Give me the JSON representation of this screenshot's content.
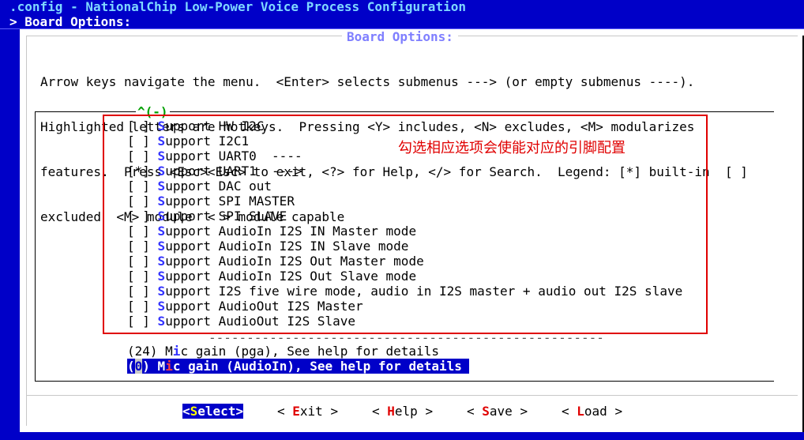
{
  "window": {
    "title": ".config - NationalChip Low-Power Voice Process Configuration",
    "breadcrumb": "> Board Options:"
  },
  "dialog": {
    "title": "Board Options:",
    "help_lines": [
      "Arrow keys navigate the menu.  <Enter> selects submenus ---> (or empty submenus ----).",
      "Highlighted letters are hotkeys.  Pressing <Y> includes, <N> excludes, <M> modularizes",
      "features.  Press <Esc><Esc> to exit, <?> for Help, </> for Search.  Legend: [*] built-in  [ ]",
      "excluded  <M> module  < > module capable"
    ],
    "scroll_indicator": "^(-)"
  },
  "menu": {
    "items": [
      {
        "check": "[ ]",
        "hot": "S",
        "rest": "upport HW I2C"
      },
      {
        "check": "[ ]",
        "hot": "S",
        "rest": "upport I2C1"
      },
      {
        "check": "[ ]",
        "hot": "S",
        "rest": "upport UART0  ----"
      },
      {
        "check": "[*]",
        "hot": "S",
        "rest": "upport UART1  --->"
      },
      {
        "check": "[ ]",
        "hot": "S",
        "rest": "upport DAC out"
      },
      {
        "check": "[ ]",
        "hot": "S",
        "rest": "upport SPI MASTER"
      },
      {
        "check": "[ ]",
        "hot": "S",
        "rest": "upport SPI SLAVE"
      },
      {
        "check": "[ ]",
        "hot": "S",
        "rest": "upport AudioIn I2S IN Master mode"
      },
      {
        "check": "[ ]",
        "hot": "S",
        "rest": "upport AudioIn I2S IN Slave mode"
      },
      {
        "check": "[ ]",
        "hot": "S",
        "rest": "upport AudioIn I2S Out Master mode"
      },
      {
        "check": "[ ]",
        "hot": "S",
        "rest": "upport AudioIn I2S Out Slave mode"
      },
      {
        "check": "[ ]",
        "hot": "S",
        "rest": "upport I2S five wire mode, audio in I2S master + audio out I2S slave"
      },
      {
        "check": "[ ]",
        "hot": "S",
        "rest": "upport AudioOut I2S Master"
      },
      {
        "check": "[ ]",
        "hot": "S",
        "rest": "upport AudioOut I2S Slave"
      }
    ],
    "separator": "----------------------------------------------------",
    "gain_pga": {
      "pre": "(24) M",
      "hot": "i",
      "post": "c gain (pga), See help for details"
    },
    "gain_audioin": {
      "open": "(",
      "cursor": "0",
      "mid": ") M",
      "hot": "i",
      "post": "c gain (AudioIn), See help for details"
    }
  },
  "annotation": {
    "text": "勾选相应选项会使能对应的引脚配置",
    "color": "#e00000"
  },
  "buttons": [
    {
      "pre": "<",
      "hot": "S",
      "post": "elect>",
      "selected": true
    },
    {
      "pre": "< ",
      "hot": "E",
      "post": "xit >",
      "selected": false
    },
    {
      "pre": "< ",
      "hot": "H",
      "post": "elp >",
      "selected": false
    },
    {
      "pre": "< ",
      "hot": "S",
      "post": "ave >",
      "selected": false
    },
    {
      "pre": "< ",
      "hot": "L",
      "post": "oad >",
      "selected": false
    }
  ],
  "colors": {
    "background": "#0000c8",
    "hotkey": "#3232ff",
    "button_hotkey": "#e00000"
  }
}
